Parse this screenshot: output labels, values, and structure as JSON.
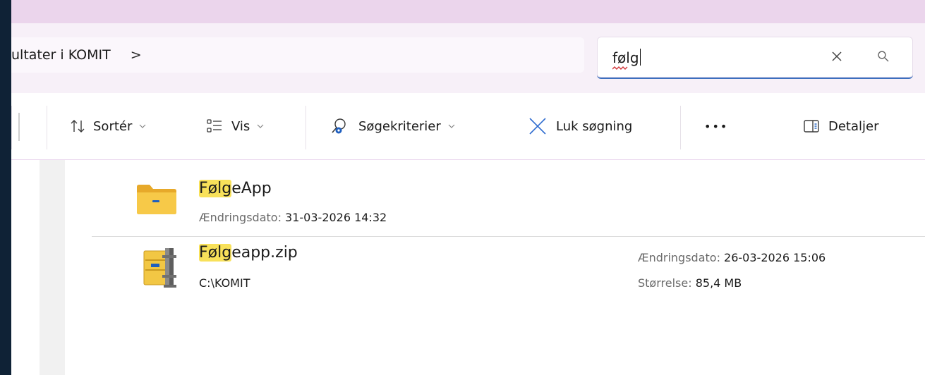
{
  "address": {
    "breadcrumb": "ultater i KOMIT",
    "chevron": ">"
  },
  "search": {
    "value": "følg",
    "placeholder": ""
  },
  "toolbar": {
    "sort_label": "Sortér",
    "view_label": "Vis",
    "criteria_label": "Søgekriterier",
    "close_search_label": "Luk søgning",
    "more_label": "•••",
    "details_label": "Detaljer"
  },
  "results": [
    {
      "name_match": "Følg",
      "name_rest": "eApp",
      "type": "folder",
      "modified_label": "Ændringsdato:",
      "modified_value": "31-03-2026 14:32"
    },
    {
      "name_match": "Følg",
      "name_rest": "eapp.zip",
      "type": "zip",
      "location": "C:\\KOMIT",
      "modified_label": "Ændringsdato:",
      "modified_value": "26-03-2026 15:06",
      "size_label": "Størrelse:",
      "size_value": "85,4 MB"
    }
  ],
  "colors": {
    "highlight": "#f8e15a",
    "search_accent": "#3b6fbf",
    "title_strip": "#ebd5ec",
    "folder_yellow": "#f7c948"
  }
}
